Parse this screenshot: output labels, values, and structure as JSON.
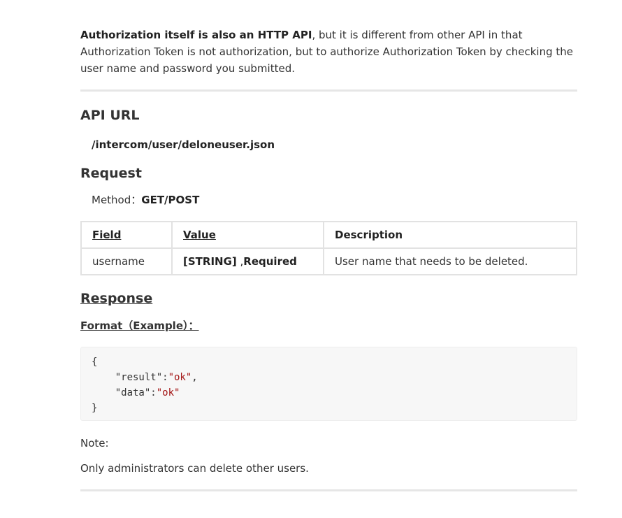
{
  "intro": {
    "strong": "Authorization itself is also an HTTP API",
    "rest": ", but it is different from other API in that Authorization Token is not authorization, but to authorize Authorization Token by checking the user name and password you submitted."
  },
  "api_url": {
    "heading": "API URL",
    "path": "/intercom/user/deloneuser.json"
  },
  "request": {
    "heading": "Request",
    "method_label": "Method：",
    "method_value": "GET/POST",
    "table": {
      "headers": [
        "Field",
        "Value",
        "Description"
      ],
      "rows": [
        {
          "field": "username",
          "value_type": "[STRING]",
          "value_sep": " ,",
          "value_req": "Required",
          "description": "User name that needs to be deleted."
        }
      ]
    }
  },
  "response": {
    "heading": "Response",
    "format_label": "Format（Example）：",
    "code": {
      "open": "{",
      "line1_key": "    \"result\":",
      "line1_val": "\"ok\"",
      "line1_end": ",",
      "line2_key": "    \"data\":",
      "line2_val": "\"ok\"",
      "close": "}"
    }
  },
  "note": {
    "label": "Note:",
    "text": "Only administrators can delete other users."
  }
}
